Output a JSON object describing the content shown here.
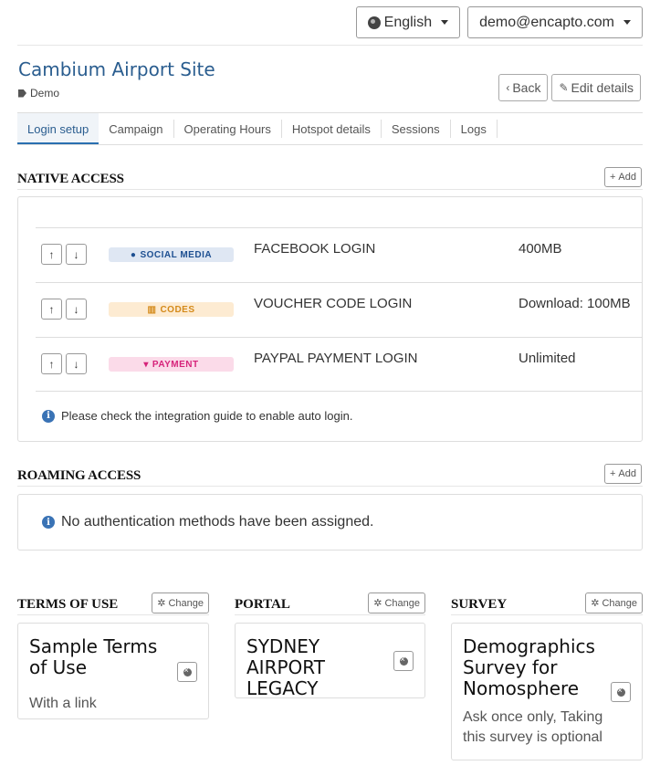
{
  "topbar": {
    "language": "English",
    "user": "demo@encapto.com"
  },
  "site": {
    "title": "Cambium Airport Site",
    "tag": "Demo"
  },
  "header_buttons": {
    "back": "Back",
    "edit": "Edit details"
  },
  "tabs": [
    "Login setup",
    "Campaign",
    "Operating Hours",
    "Hotspot details",
    "Sessions",
    "Logs"
  ],
  "native_access": {
    "title": "NATIVE ACCESS",
    "add_label": "Add",
    "methods": [
      {
        "badge": "SOCIAL MEDIA",
        "badge_icon": "users-icon",
        "badge_color": "#dfe7f3",
        "badge_text_color": "#1d4f91",
        "name": "FACEBOOK LOGIN",
        "quota": "400MB"
      },
      {
        "badge": "CODES",
        "badge_icon": "barcode-icon",
        "badge_color": "#fdebd2",
        "badge_text_color": "#d48a1a",
        "name": "VOUCHER CODE LOGIN",
        "quota": "Download: 100MB"
      },
      {
        "badge": "PAYMENT",
        "badge_icon": "cart-icon",
        "badge_color": "#fbdbe9",
        "badge_text_color": "#d6237a",
        "name": "PAYPAL PAYMENT LOGIN",
        "quota": "Unlimited"
      }
    ],
    "note": "Please check the integration guide to enable auto login."
  },
  "roaming_access": {
    "title": "ROAMING ACCESS",
    "add_label": "Add",
    "note": "No authentication methods have been assigned."
  },
  "terms": {
    "title": "TERMS OF USE",
    "change_label": "Change",
    "card_title": "Sample Terms of Use",
    "card_sub": "With a link"
  },
  "portal": {
    "title": "PORTAL",
    "change_label": "Change",
    "card_title": "SYDNEY AIRPORT LEGACY"
  },
  "survey": {
    "title": "SURVEY",
    "change_label": "Change",
    "card_title": "Demographics Survey for Nomosphere",
    "card_sub": "Ask once only, Taking this survey is optional"
  },
  "colors": {
    "accent": "#2a6fb0",
    "title": "#2a5d8f",
    "info": "#3a73b5"
  }
}
